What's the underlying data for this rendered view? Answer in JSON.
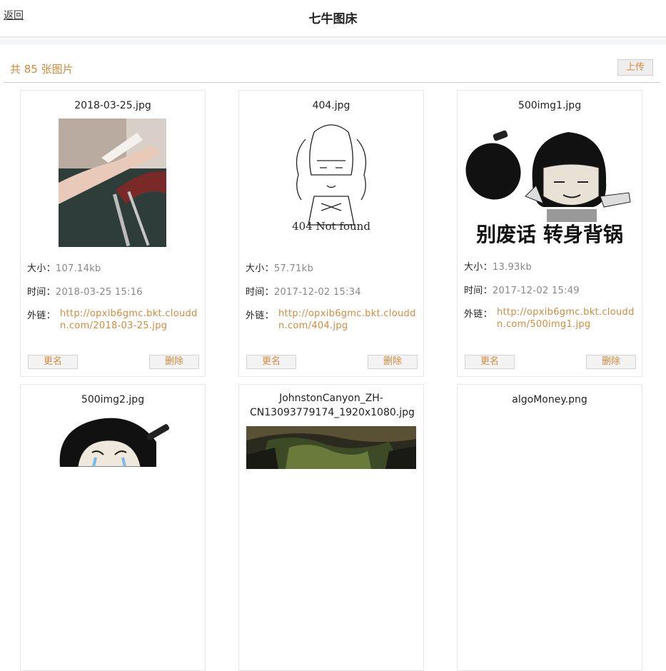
{
  "header": {
    "back_label": "返回",
    "title": "七牛图床"
  },
  "toolbar": {
    "count_label": "共 85 张图片",
    "upload_label": "上传"
  },
  "labels": {
    "size": "大小：",
    "time": "时间：",
    "link": "外链：",
    "rename": "更名",
    "delete": "删除"
  },
  "images": [
    {
      "name": "2018-03-25.jpg",
      "size": "107.14kb",
      "time": "2018-03-25 15:16",
      "link": "http://opxib6gmc.bkt.clouddn.com/2018-03-25.jpg"
    },
    {
      "name": "404.jpg",
      "size": "57.71kb",
      "time": "2017-12-02 15:34",
      "link": "http://opxib6gmc.bkt.clouddn.com/404.jpg",
      "thumb_text": "404 Not found"
    },
    {
      "name": "500img1.jpg",
      "size": "13.93kb",
      "time": "2017-12-02 15:49",
      "link": "http://opxib6gmc.bkt.clouddn.com/500img1.jpg",
      "thumb_text": "别废话 转身背锅"
    },
    {
      "name": "500img2.jpg"
    },
    {
      "name": "JohnstonCanyon_ZH-CN13093779174_1920x1080.jpg"
    },
    {
      "name": "algoMoney.png"
    }
  ],
  "colors": {
    "accent": "#d58a3c",
    "muted": "#888888"
  }
}
